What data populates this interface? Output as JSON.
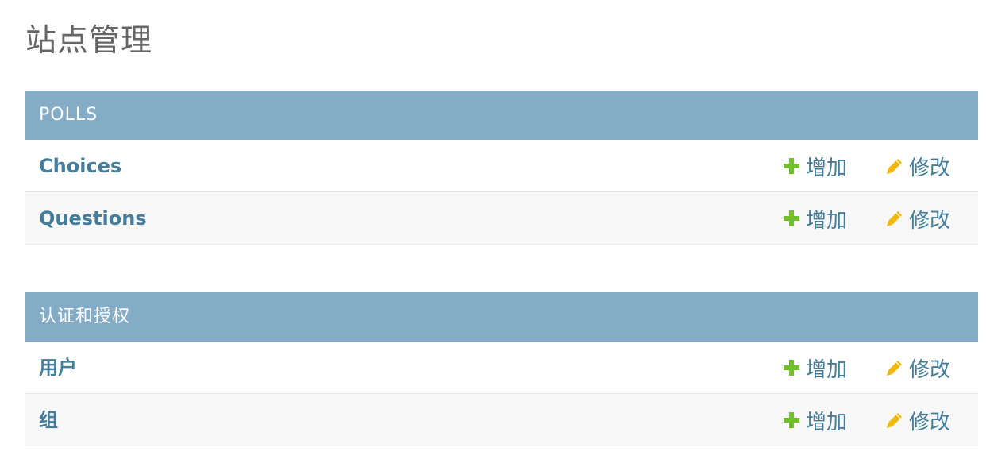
{
  "page": {
    "title": "站点管理"
  },
  "colors": {
    "header_bg": "#85acc6",
    "link": "#447e9b",
    "add_icon": "#70bf2b",
    "change_icon": "#efb80b"
  },
  "modules": [
    {
      "name": "POLLS",
      "rows": [
        {
          "name": "Choices",
          "add_label": "增加",
          "change_label": "修改",
          "add_icon": "plus-icon",
          "change_icon": "pencil-icon"
        },
        {
          "name": "Questions",
          "add_label": "增加",
          "change_label": "修改",
          "add_icon": "plus-icon",
          "change_icon": "pencil-icon"
        }
      ]
    },
    {
      "name": "认证和授权",
      "rows": [
        {
          "name": "用户",
          "add_label": "增加",
          "change_label": "修改",
          "add_icon": "plus-icon",
          "change_icon": "pencil-icon"
        },
        {
          "name": "组",
          "add_label": "增加",
          "change_label": "修改",
          "add_icon": "plus-icon",
          "change_icon": "pencil-icon"
        }
      ]
    }
  ]
}
